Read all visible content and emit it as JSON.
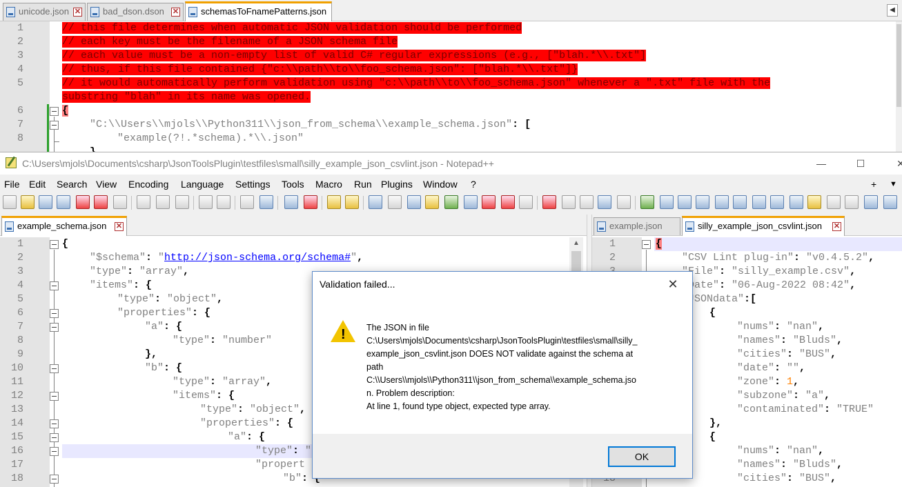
{
  "bg_window": {
    "tabs": [
      {
        "label": "unicode.json"
      },
      {
        "label": "bad_dson.dson"
      },
      {
        "label": "schemasToFnamePatterns.json"
      }
    ],
    "line_numbers": [
      "1",
      "2",
      "3",
      "4",
      "5",
      "",
      "6",
      "7",
      "8"
    ],
    "lines": [
      "// this file determines when automatic JSON validation should be performed",
      "// each key must be the filename of a JSON schema file",
      "// each value must be a non-empty list of valid C# regular expressions (e.g., [\"blah.*\\\\.txt\"]",
      "// thus, if this file contained {\"c:\\\\path\\\\to\\\\foo_schema.json\": [\"blah.*\\\\.txt\"]}",
      "// it would automatically perform validation using \"c:\\\\path\\\\to\\\\foo_schema.json\" whenever a \".txt\" file with the",
      "substring \"blah\" in its name was opened.",
      "{",
      "\"C:\\\\Users\\\\mjols\\\\Python311\\\\json_from_schema\\\\example_schema.json\"",
      ": [",
      "\"example(?!.*schema).*\\\\.json\""
    ]
  },
  "main_window": {
    "title": "C:\\Users\\mjols\\Documents\\csharp\\JsonToolsPlugin\\testfiles\\small\\silly_example_json_csvlint.json - Notepad++",
    "menu": [
      "File",
      "Edit",
      "Search",
      "View",
      "Encoding",
      "Language",
      "Settings",
      "Tools",
      "Macro",
      "Run",
      "Plugins",
      "Window",
      "?"
    ],
    "menu_right": [
      "+",
      "▼",
      "✕"
    ],
    "left_pane": {
      "tab": "example_schema.json",
      "line_numbers": [
        "1",
        "2",
        "3",
        "4",
        "5",
        "6",
        "7",
        "8",
        "9",
        "10",
        "11",
        "12",
        "13",
        "14",
        "15",
        "16",
        "17",
        "18"
      ],
      "t": {
        "l1": "{",
        "schema_key": "\"$schema\"",
        "schema_val": "\"http://json-schema.org/schema#\"",
        "type_key": "\"type\"",
        "array": "\"array\"",
        "items_key": "\"items\"",
        "object": "\"object\"",
        "props_key": "\"properties\"",
        "a_key": "\"a\"",
        "number": "\"number\"",
        "b_key": "\"b\"",
        "object_cut": "\"object\"",
        "props_cut": "\"propert",
        "b_key2": "\"b\"",
        "quote": "\""
      }
    },
    "right_pane": {
      "tabs": [
        {
          "label": "example.json"
        },
        {
          "label": "silly_example_json_csvlint.json"
        }
      ],
      "line_numbers": [
        "1",
        "2",
        "3",
        "",
        "",
        "",
        "",
        "",
        "",
        "",
        "",
        "",
        "",
        "",
        "",
        "",
        "",
        "18"
      ],
      "t": {
        "l1": "{",
        "csv_key": "\"CSV Lint plug-in\"",
        "csv_val": "\"v0.4.5.2\"",
        "file_key": "\"File\"",
        "file_val": "\"silly_example.csv\"",
        "date_key": "\"Date\"",
        "date_val": "\"06-Aug-2022 08:42\"",
        "jd_key": "\"JSONdata\"",
        "nums_key": "\"nums\"",
        "nan": "\"nan\"",
        "names_key": "\"names\"",
        "bluds": "\"Bluds\"",
        "cities_key": "\"cities\"",
        "bus": "\"BUS\"",
        "date2_key": "\"date\"",
        "empty": "\"\"",
        "zone_key": "\"zone\"",
        "one": "1",
        "subzone_key": "\"subzone\"",
        "a_val": "\"a\"",
        "cont_key": "\"contaminated\"",
        "true_val": "\"TRUE\""
      }
    }
  },
  "dialog": {
    "title": "Validation failed...",
    "message_lines": [
      "The JSON in file",
      "C:\\Users\\mjols\\Documents\\csharp\\JsonToolsPlugin\\testfiles\\small\\silly_",
      "example_json_csvlint.json DOES NOT validate against the schema at",
      "path",
      "C:\\\\Users\\\\mjols\\\\Python311\\\\json_from_schema\\\\example_schema.jso",
      "n. Problem description:",
      "At line 1, found type object, expected type array."
    ],
    "ok": "OK"
  },
  "colors": {
    "highlight": "#ff0000",
    "keyword": "#000080",
    "string": "#808080",
    "number": "#ff8000",
    "link": "#0000ff"
  },
  "icons": [
    "file-icon",
    "close-tab-icon",
    "warning-icon",
    "minimize-icon",
    "maximize-icon",
    "close-icon"
  ]
}
